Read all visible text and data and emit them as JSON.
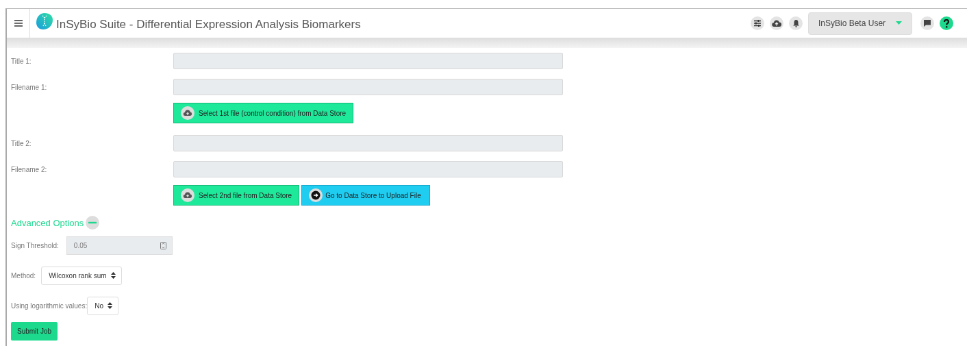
{
  "header": {
    "title": "InSyBio Suite - Differential Expression Analysis Biomarkers",
    "user": "InSyBio Beta User"
  },
  "file_groups": [
    {
      "fields": [
        {
          "label": "Title 1:"
        },
        {
          "label": "Filename 1:"
        }
      ],
      "buttons": [
        {
          "label": "Select 1st file (control condition) from Data Store",
          "kind": "select"
        }
      ]
    },
    {
      "fields": [
        {
          "label": "Title 2:"
        },
        {
          "label": "Filename 2:"
        }
      ],
      "buttons": [
        {
          "label": "Select 2nd file from Data Store",
          "kind": "select"
        },
        {
          "label": "Go to Data Store to Upload File",
          "kind": "goto"
        }
      ]
    }
  ],
  "advanced": {
    "title": "Advanced Options",
    "expanded": true,
    "options": [
      {
        "label": "Sign Threshold:",
        "kind": "number",
        "value": "0.05"
      },
      {
        "label": "Method:",
        "kind": "select",
        "value": "Wilcoxon rank sum"
      },
      {
        "label": "Using logarithmic values:",
        "kind": "select",
        "value": "No"
      }
    ]
  },
  "submit": "Submit Job"
}
